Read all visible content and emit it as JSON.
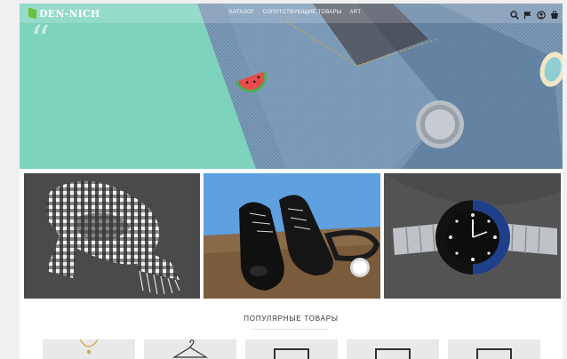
{
  "header": {
    "logo_text": "DEN-NICH",
    "nav": [
      "КАТАЛОГ",
      "СОПУТСТВУЮЩИЕ ТОВАРЫ",
      "ART"
    ],
    "icons": [
      "search-icon",
      "flag-icon",
      "user-icon",
      "cart-icon"
    ]
  },
  "hero": {
    "accent_color": "#7ed3bd",
    "quote_mark": "“"
  },
  "categories": [
    {
      "image": "scarf"
    },
    {
      "image": "shoes"
    },
    {
      "image": "watch"
    }
  ],
  "popular": {
    "title": "ПОПУЛЯРНЫЕ ТОВАРЫ",
    "products": [
      {
        "image": "necklace"
      },
      {
        "image": "hanger"
      },
      {
        "image": "frame"
      },
      {
        "image": "frame"
      },
      {
        "image": "frame"
      }
    ]
  }
}
